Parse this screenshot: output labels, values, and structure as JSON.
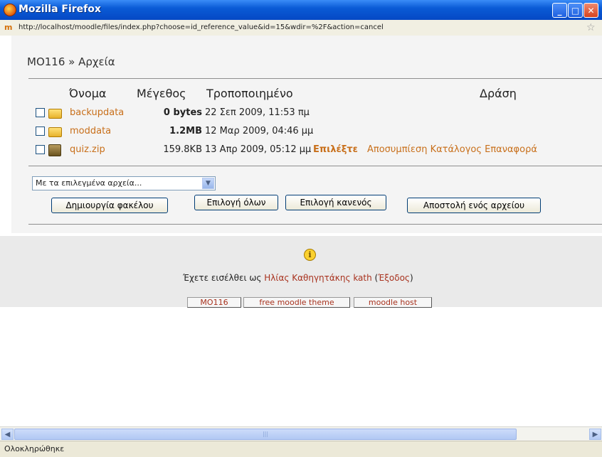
{
  "window": {
    "title": "Mozilla Firefox"
  },
  "urlbar": {
    "url": "http://localhost/moodle/files/index.php?choose=id_reference_value&id=15&wdir=%2F&action=cancel"
  },
  "breadcrumb": "MO116 » Αρχεία",
  "table": {
    "headers": {
      "name": "Όνομα",
      "size": "Μέγεθος",
      "modified": "Τροποποιημένο",
      "action": "Δράση"
    },
    "rows": [
      {
        "name": "backupdata",
        "size": "0 bytes",
        "date": "22 Σεπ 2009, 11:53 πμ",
        "icon": "folder-icon",
        "action_choose": "",
        "action_links": ""
      },
      {
        "name": "moddata",
        "size": "1.2MB",
        "date": "12 Μαρ 2009, 04:46 μμ",
        "icon": "folder-icon",
        "action_choose": "",
        "action_links": ""
      },
      {
        "name": "quiz.zip",
        "size": "159.8KB",
        "date": "13 Απρ 2009, 05:12 μμ",
        "icon": "zip-icon",
        "action_choose": "Επιλέξτε",
        "action_links": "Αποσυμπίεση Κατάλογος Επαναφορά"
      }
    ]
  },
  "select": {
    "value": "Με τα επιλεγμένα αρχεία..."
  },
  "buttons": {
    "create_folder": "Δημιουργία φακέλου",
    "select_all": "Επιλογή όλων",
    "select_none": "Επιλογή κανενός",
    "upload": "Αποστολή ενός αρχείου"
  },
  "footer": {
    "login_prefix": "Έχετε εισέλθει ως",
    "user": "Ηλίας Καθηγητάκης kath",
    "logout": "Έξοδος",
    "links": [
      "MO116",
      "free moodle theme",
      "moodle host"
    ]
  },
  "statusbar": {
    "text": "Ολοκληρώθηκε"
  },
  "colors": {
    "link": "#c86f1a",
    "footer_link": "#a8321e",
    "titlebar": "#0a5bd6"
  }
}
